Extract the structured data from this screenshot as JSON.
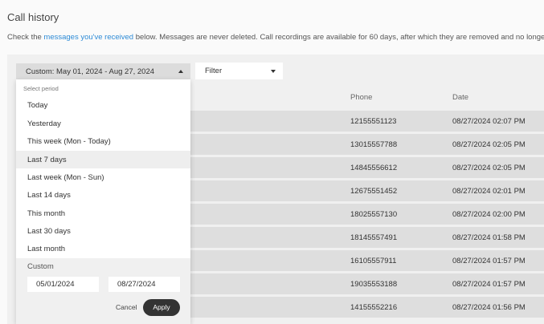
{
  "page": {
    "title": "Call history",
    "intro_prefix": "Check the ",
    "intro_link": "messages you've received",
    "intro_suffix": " below. Messages are never deleted. Call recordings are available for 60 days, after which they are removed and no longer r"
  },
  "toolbar": {
    "period_value": "Custom: May 01, 2024 - Aug 27, 2024",
    "filter_label": "Filter"
  },
  "table": {
    "columns": {
      "phone": "Phone",
      "date": "Date"
    },
    "rows": [
      {
        "phone": "12155551123",
        "date": "08/27/2024 02:07 PM"
      },
      {
        "phone": "13015557788",
        "date": "08/27/2024 02:05 PM"
      },
      {
        "phone": "14845556612",
        "date": "08/27/2024 02:05 PM"
      },
      {
        "phone": "12675551452",
        "date": "08/27/2024 02:01 PM"
      },
      {
        "phone": "18025557130",
        "date": "08/27/2024 02:00 PM"
      },
      {
        "phone": "18145557491",
        "date": "08/27/2024 01:58 PM"
      },
      {
        "phone": "16105557911",
        "date": "08/27/2024 01:57 PM"
      },
      {
        "phone": "19035553188",
        "date": "08/27/2024 01:57 PM"
      },
      {
        "phone": "14155552216",
        "date": "08/27/2024 01:56 PM"
      }
    ]
  },
  "period_dropdown": {
    "header": "Select period",
    "options": [
      "Today",
      "Yesterday",
      "This week (Mon - Today)",
      "Last 7 days",
      "Last week (Mon - Sun)",
      "Last 14 days",
      "This month",
      "Last 30 days",
      "Last month"
    ],
    "selected_option": "Last 7 days",
    "custom_label": "Custom",
    "custom_start": "05/01/2024",
    "custom_end": "08/27/2024",
    "cancel_label": "Cancel",
    "apply_label": "Apply"
  },
  "colors": {
    "link": "#2e8bd6",
    "row_background": "#dedede",
    "apply_button": "#333333"
  }
}
